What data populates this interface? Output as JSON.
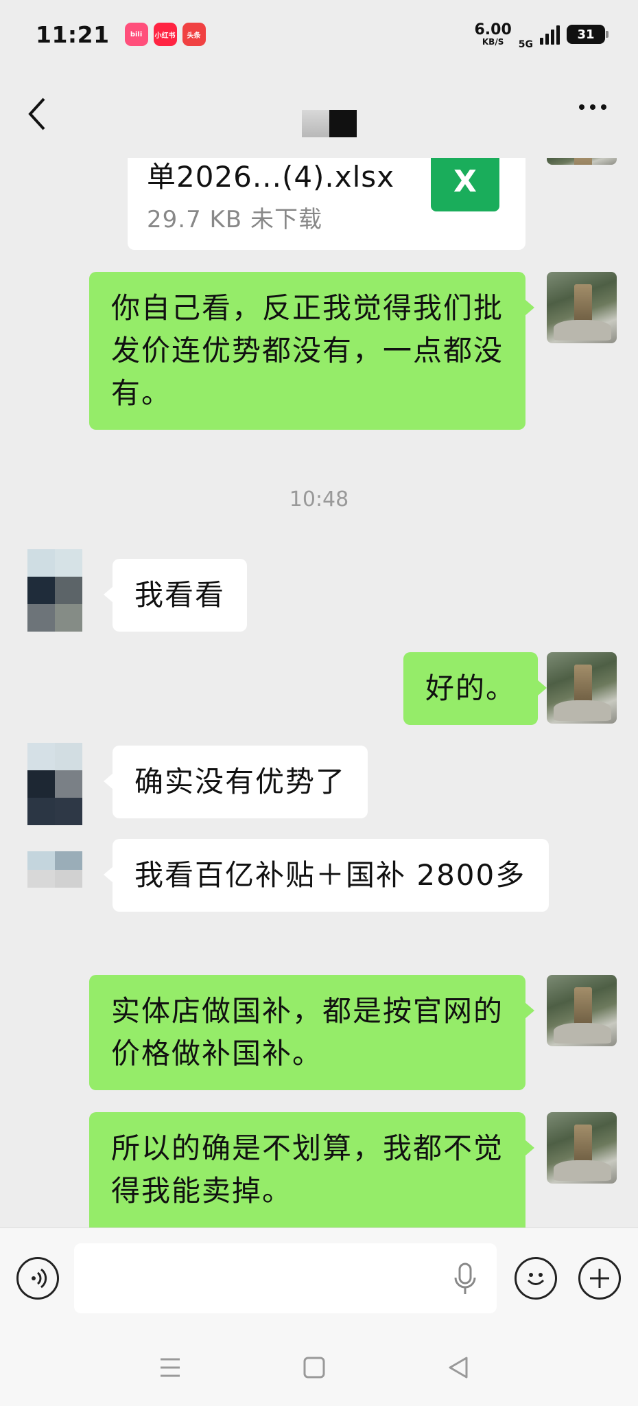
{
  "status_bar": {
    "time": "11:21",
    "apps": [
      {
        "name": "bilibili-app-icon",
        "label": "bili",
        "color": "#ff4f7b"
      },
      {
        "name": "xiaohongshu-app-icon",
        "label": "小红书",
        "color": "#ff2442"
      },
      {
        "name": "toutiao-app-icon",
        "label": "头条",
        "color": "#f04142"
      }
    ],
    "speed_value": "6.00",
    "speed_unit": "KB/S",
    "network": "5G",
    "battery": "31"
  },
  "header": {
    "title": ""
  },
  "messages": [
    {
      "type": "file",
      "side": "other",
      "file_name": "单2026...(4).xlsx",
      "file_size": "29.7 KB  未下载",
      "icon_label": "X"
    },
    {
      "type": "text",
      "side": "me",
      "text": "你自己看，反正我觉得我们批发价连优势都没有，一点都没有。"
    },
    {
      "type": "time",
      "text": "10:48"
    },
    {
      "type": "text",
      "side": "other",
      "text": "我看看"
    },
    {
      "type": "text",
      "side": "me",
      "text": "好的。"
    },
    {
      "type": "text",
      "side": "other",
      "text": "确实没有优势了"
    },
    {
      "type": "text",
      "side": "other",
      "text": "我看百亿补贴＋国补 2800多"
    },
    {
      "type": "text",
      "side": "me",
      "text": "实体店做国补，都是按官网的价格做补国补。"
    },
    {
      "type": "text",
      "side": "me",
      "text": "所以的确是不划算，我都不觉得我能卖掉。"
    }
  ],
  "input": {
    "value": "",
    "placeholder": ""
  },
  "colors": {
    "my_bubble": "#95ec69",
    "other_bubble": "#ffffff",
    "background": "#ededed"
  }
}
